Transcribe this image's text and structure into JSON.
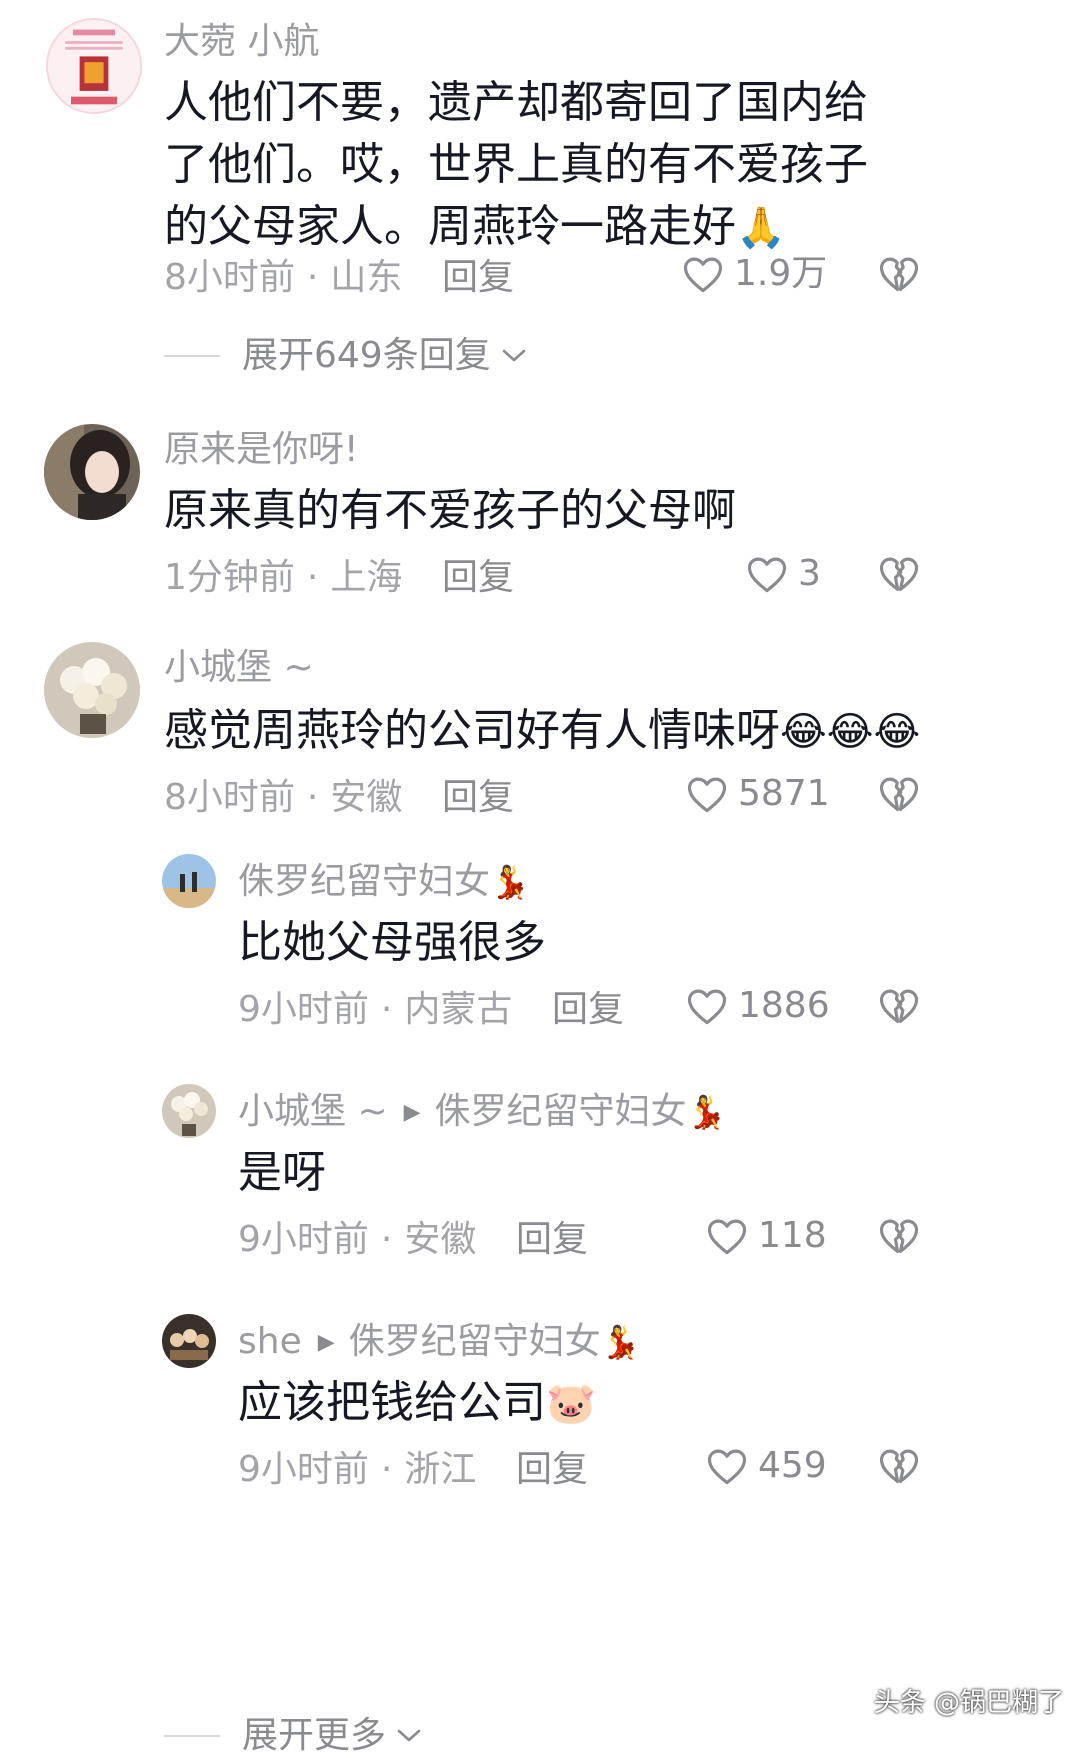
{
  "comments": [
    {
      "user": "大菀 小航",
      "text": "人他们不要，遗产却都寄回了国内给了他们。哎，世界上真的有不爱孩子的父母家人。周燕玲一路走好",
      "emoji": "🙏",
      "time": "8小时前",
      "location": "山东",
      "reply_label": "回复",
      "likes": "1.9万",
      "expand_label": "展开649条回复"
    },
    {
      "user": "原来是你呀!",
      "text": "原来真的有不爱孩子的父母啊",
      "time": "1分钟前",
      "location": "上海",
      "reply_label": "回复",
      "likes": "3"
    },
    {
      "user": "小城堡 ~",
      "text": "感觉周燕玲的公司好有人情味呀",
      "emoji": "😂😂😂",
      "time": "8小时前",
      "location": "安徽",
      "reply_label": "回复",
      "likes": "5871"
    }
  ],
  "replies": [
    {
      "user": "侏罗纪留守妇女",
      "user_emoji": "💃",
      "text": "比她父母强很多",
      "time": "9小时前",
      "location": "内蒙古",
      "reply_label": "回复",
      "likes": "1886"
    },
    {
      "user": "小城堡 ~",
      "reply_to": "侏罗纪留守妇女",
      "reply_to_emoji": "💃",
      "text": "是呀",
      "time": "9小时前",
      "location": "安徽",
      "reply_label": "回复",
      "likes": "118"
    },
    {
      "user": "she",
      "reply_to": "侏罗纪留守妇女",
      "reply_to_emoji": "💃",
      "text": "应该把钱给公司",
      "emoji": "🐷",
      "time": "9小时前",
      "location": "浙江",
      "reply_label": "回复",
      "likes": "459"
    }
  ],
  "expand_more_label": "展开更多",
  "watermark": "头条 @锅巴糊了",
  "icons": {
    "like": "heart-outline-icon",
    "dislike": "broken-heart-icon",
    "expand": "chevron-down-icon",
    "reply_arrow": "play-triangle-icon"
  },
  "colors": {
    "text_primary": "#161823",
    "text_secondary": "#9b9ca2",
    "background": "#ffffff"
  }
}
